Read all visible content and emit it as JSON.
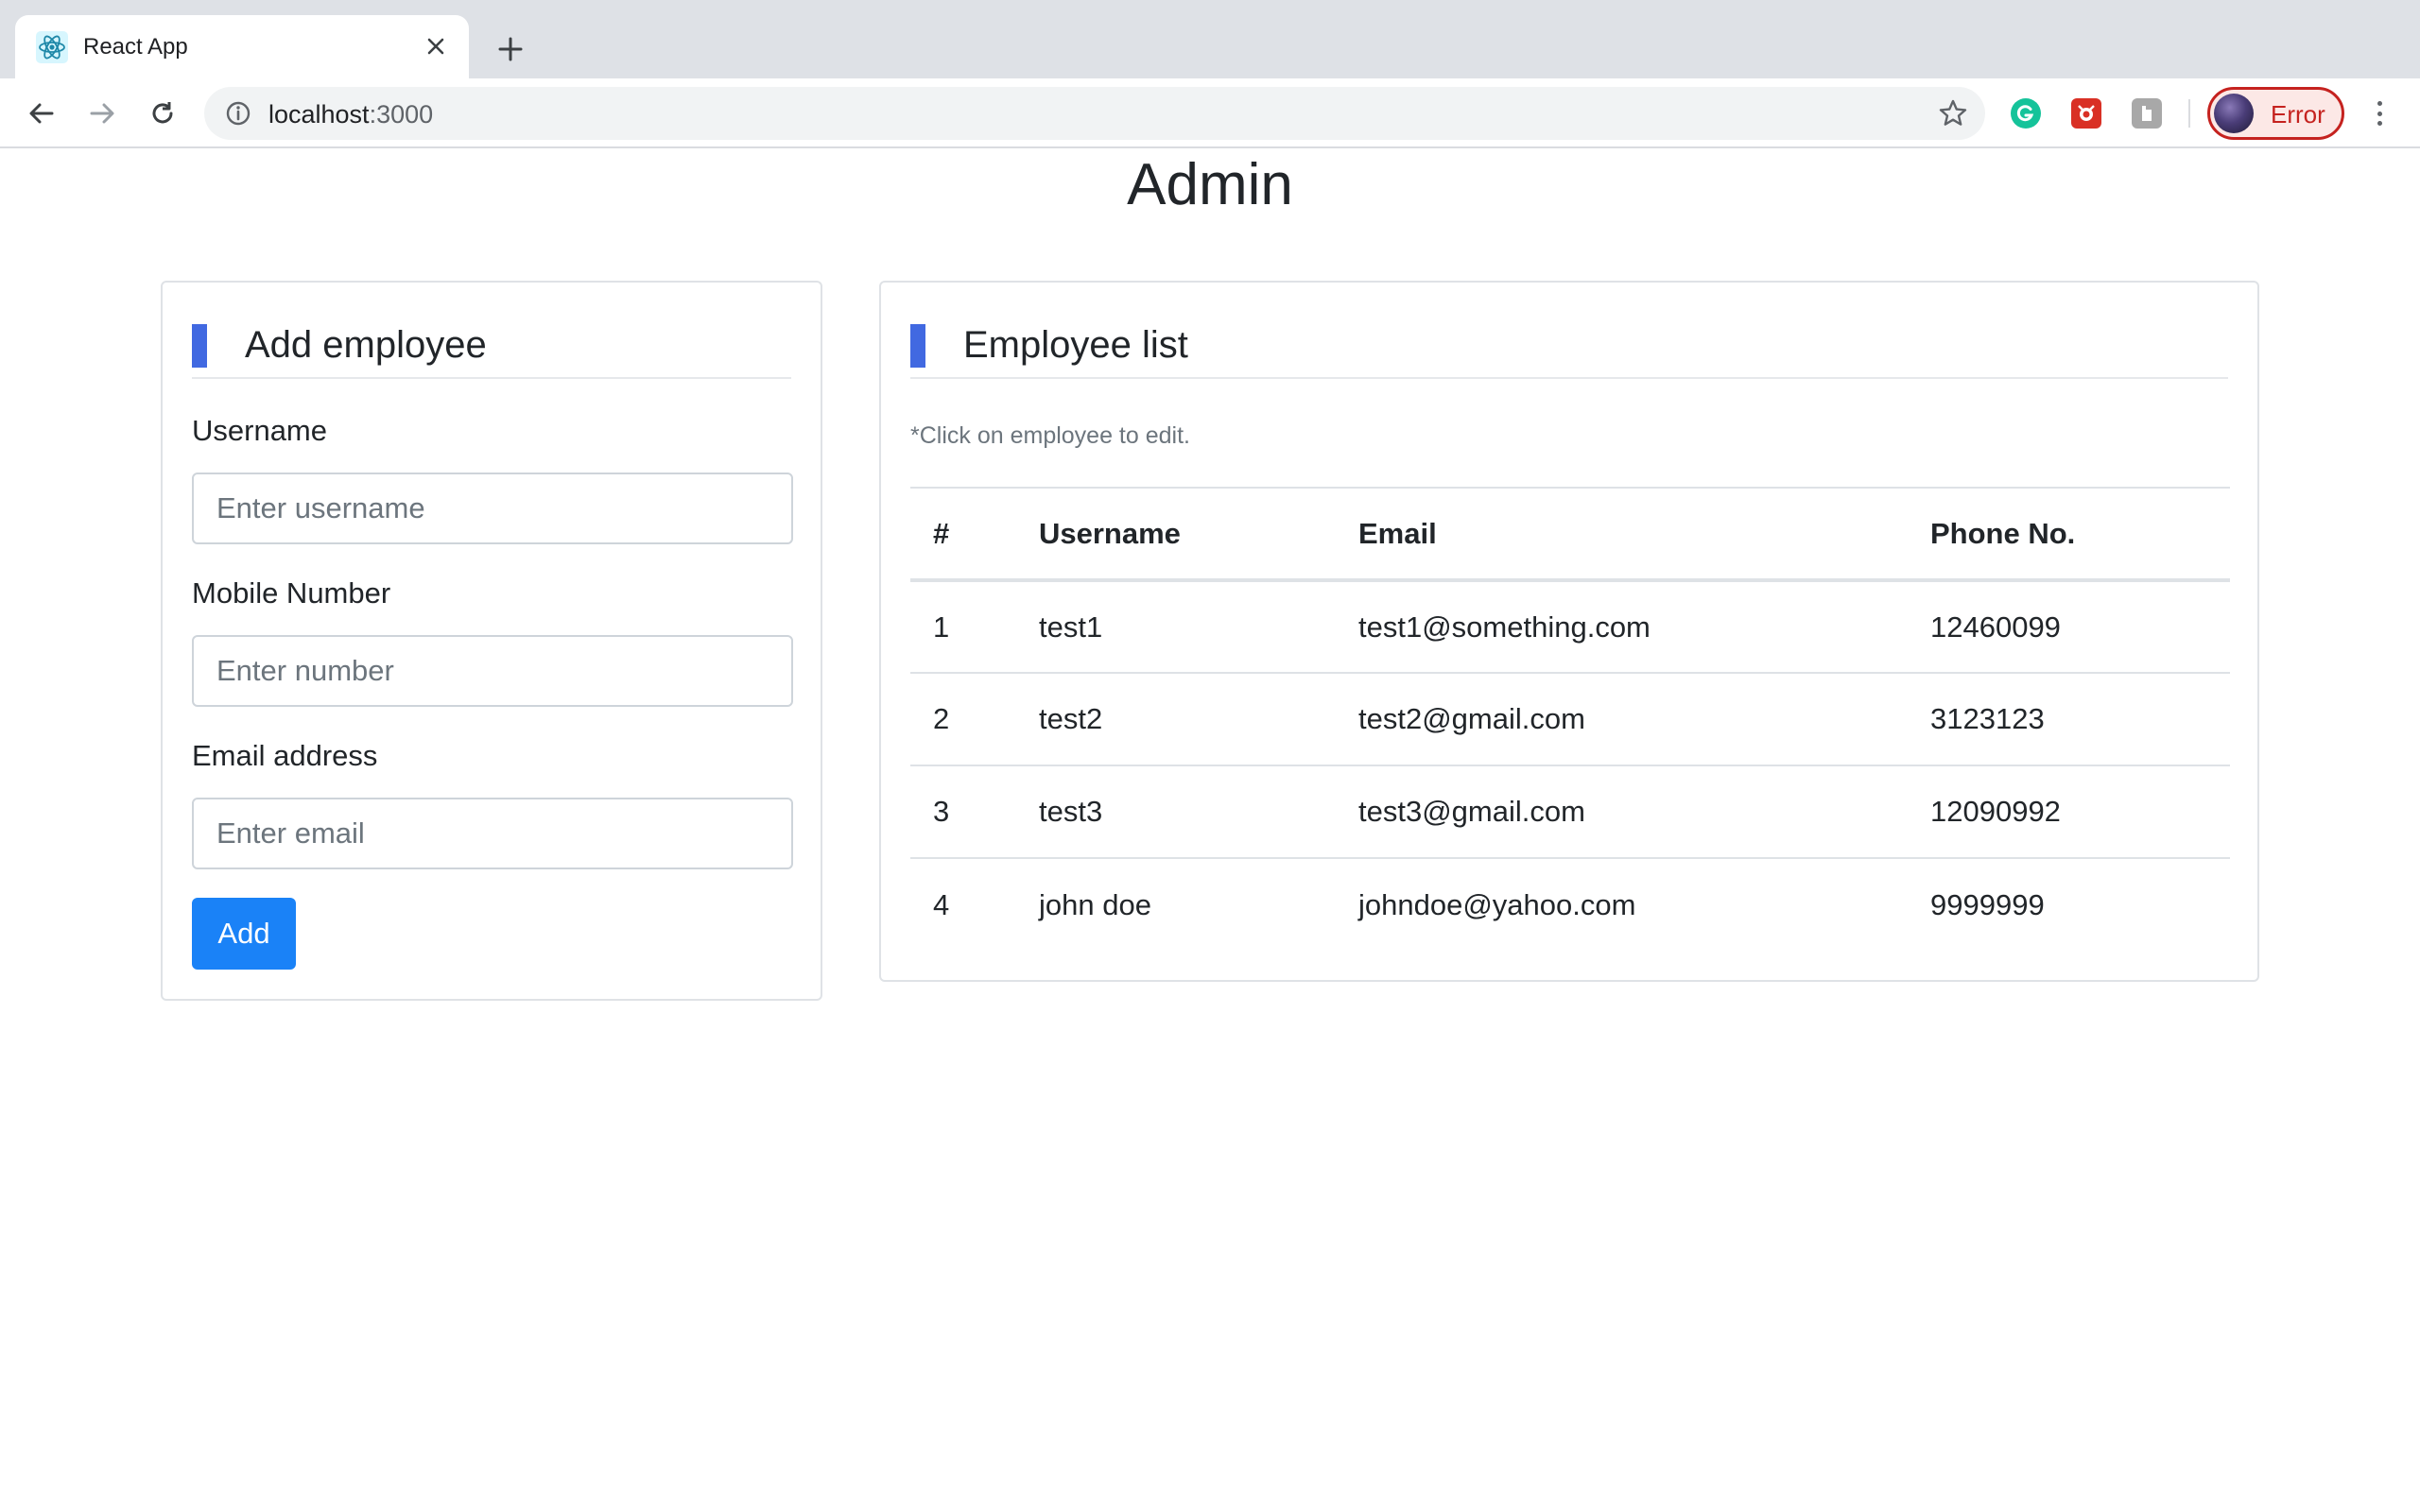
{
  "browser": {
    "tab_title": "React App",
    "url_host": "localhost",
    "url_port": ":3000",
    "profile_label": "Error"
  },
  "page": {
    "title": "Admin"
  },
  "add_employee": {
    "title": "Add employee",
    "fields": [
      {
        "label": "Username",
        "placeholder": "Enter username"
      },
      {
        "label": "Mobile Number",
        "placeholder": "Enter number"
      },
      {
        "label": "Email address",
        "placeholder": "Enter email"
      }
    ],
    "submit_label": "Add"
  },
  "employee_list": {
    "title": "Employee list",
    "hint": "*Click on employee to edit.",
    "columns": [
      "#",
      "Username",
      "Email",
      "Phone No."
    ],
    "rows": [
      {
        "id": "1",
        "username": "test1",
        "email": "test1@something.com",
        "phone": "12460099"
      },
      {
        "id": "2",
        "username": "test2",
        "email": "test2@gmail.com",
        "phone": "3123123"
      },
      {
        "id": "3",
        "username": "test3",
        "email": "test3@gmail.com",
        "phone": "12090992"
      },
      {
        "id": "4",
        "username": "john doe",
        "email": "johndoe@yahoo.com",
        "phone": "9999999"
      }
    ]
  },
  "colors": {
    "accent": "#4169e1",
    "primary_button": "#1a82f7",
    "profile_error": "#c5221f"
  }
}
